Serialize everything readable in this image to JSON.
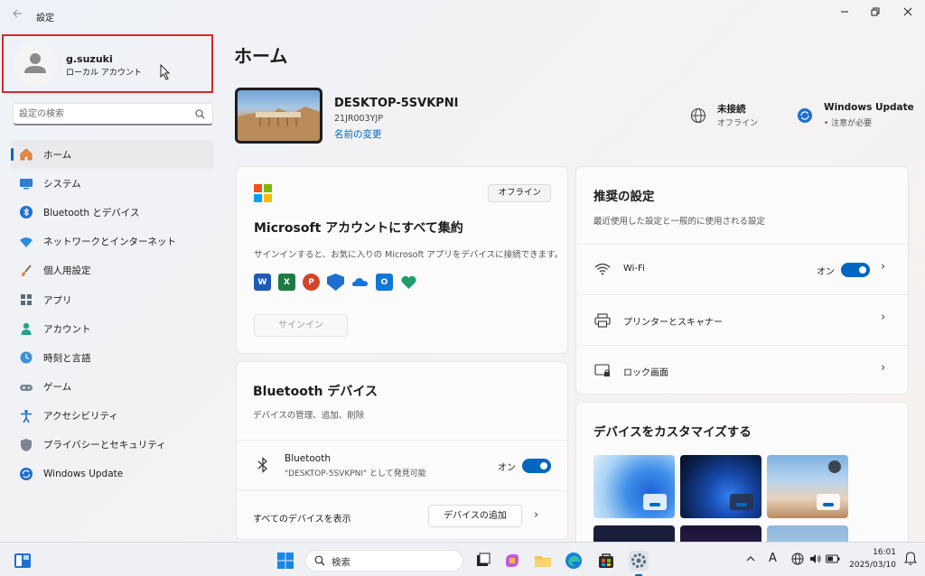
{
  "window": {
    "title": "設定"
  },
  "profile": {
    "name": "g.suzuki",
    "account_type": "ローカル アカウント"
  },
  "search": {
    "placeholder": "設定の検索"
  },
  "nav": {
    "items": [
      {
        "label": "ホーム",
        "icon": "home-icon"
      },
      {
        "label": "システム",
        "icon": "system-icon"
      },
      {
        "label": "Bluetooth とデバイス",
        "icon": "bluetooth-icon"
      },
      {
        "label": "ネットワークとインターネット",
        "icon": "wifi-icon"
      },
      {
        "label": "個人用設定",
        "icon": "brush-icon"
      },
      {
        "label": "アプリ",
        "icon": "apps-icon"
      },
      {
        "label": "アカウント",
        "icon": "account-icon"
      },
      {
        "label": "時刻と言語",
        "icon": "clock-globe-icon"
      },
      {
        "label": "ゲーム",
        "icon": "gamepad-icon"
      },
      {
        "label": "アクセシビリティ",
        "icon": "accessibility-icon"
      },
      {
        "label": "プライバシーとセキュリティ",
        "icon": "shield-icon"
      },
      {
        "label": "Windows Update",
        "icon": "update-icon"
      }
    ]
  },
  "main": {
    "title": "ホーム",
    "device": {
      "name": "DESKTOP-5SVKPNI",
      "model": "21JR003YJP",
      "rename_link": "名前の変更"
    },
    "network_status": {
      "title": "未接続",
      "subtitle": "オフライン"
    },
    "update_status": {
      "title": "Windows Update",
      "subtitle": "• 注意が必要"
    },
    "ms_account_card": {
      "badge": "オフライン",
      "title": "Microsoft アカウントにすべて集約",
      "description": "サインインすると、お気に入りの Microsoft アプリをデバイスに接続できます。",
      "signin_button": "サインイン",
      "app_icons": [
        "word-icon",
        "excel-icon",
        "powerpoint-icon",
        "defender-icon",
        "onedrive-icon",
        "outlook-icon",
        "family-icon"
      ]
    },
    "bluetooth_card": {
      "title": "Bluetooth デバイス",
      "subtitle": "デバイスの管理、追加、削除",
      "row_title": "Bluetooth",
      "row_subtitle": "\"DESKTOP-5SVKPNI\" として発見可能",
      "toggle_label": "オン",
      "toggle_on": true,
      "show_all": "すべてのデバイスを表示",
      "add_button": "デバイスの追加"
    },
    "recommended_card": {
      "title": "推奨の設定",
      "subtitle": "最近使用した設定と一般的に使用される設定",
      "rows": [
        {
          "label": "Wi-Fi",
          "icon": "wifi-icon",
          "toggle_label": "オン",
          "toggle_on": true
        },
        {
          "label": "プリンターとスキャナー",
          "icon": "printer-icon"
        },
        {
          "label": "ロック画面",
          "icon": "lock-screen-icon"
        }
      ]
    },
    "customize_card": {
      "title": "デバイスをカスタマイズする"
    }
  },
  "taskbar": {
    "search_label": "検索",
    "time": "16:01",
    "date": "2025/03/10",
    "ime": "A"
  },
  "colors": {
    "accent": "#0067c0",
    "highlight_border": "#e0232a"
  }
}
